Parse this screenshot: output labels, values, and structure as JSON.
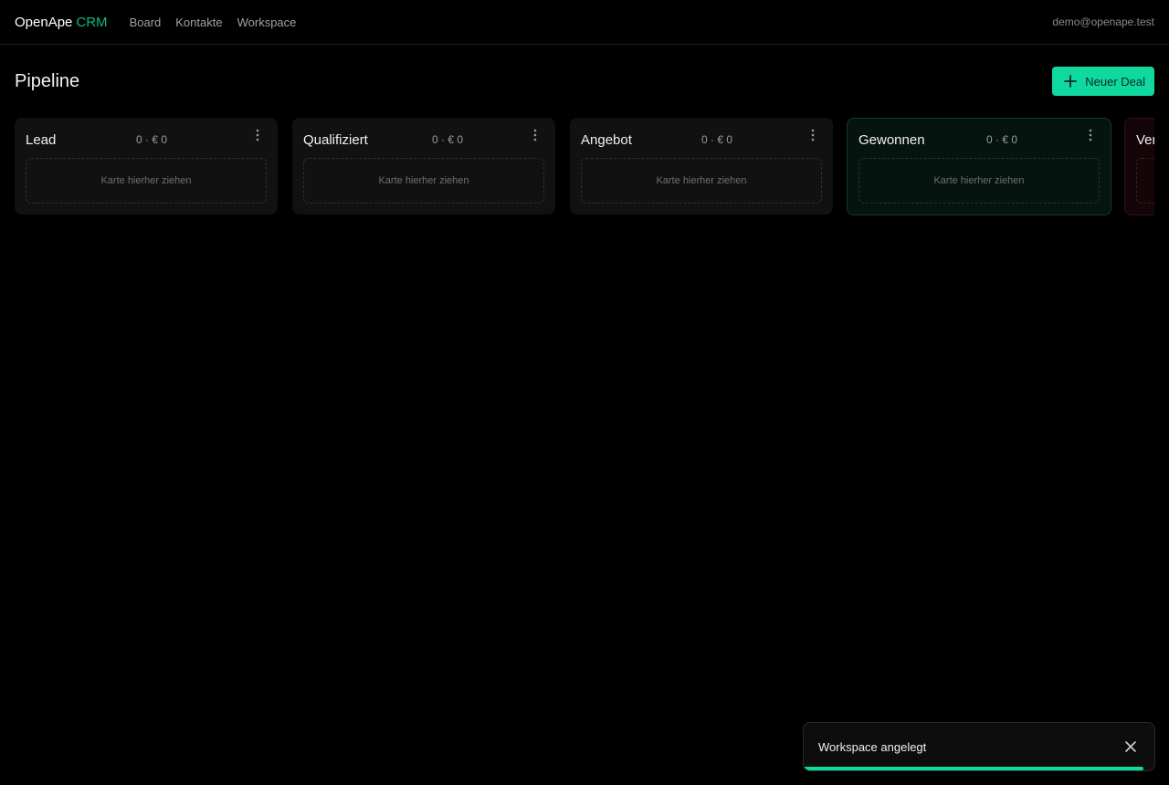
{
  "app": {
    "name": "OpenApe",
    "name_accent": "CRM"
  },
  "nav": {
    "items": [
      {
        "label": "Board"
      },
      {
        "label": "Kontakte"
      },
      {
        "label": "Workspace"
      }
    ]
  },
  "user": {
    "email": "demo@openape.test"
  },
  "page": {
    "title": "Pipeline",
    "new_deal_label": "Neuer Deal"
  },
  "columns": [
    {
      "title": "Lead",
      "meta": "0 · € 0",
      "dropzone": "Karte hierher ziehen"
    },
    {
      "title": "Qualifiziert",
      "meta": "0 · € 0",
      "dropzone": "Karte hierher ziehen"
    },
    {
      "title": "Angebot",
      "meta": "0 · € 0",
      "dropzone": "Karte hierher ziehen"
    },
    {
      "title": "Gewonnen",
      "meta": "0 · € 0",
      "dropzone": "Karte hierher ziehen"
    },
    {
      "title": "Ver",
      "meta": "",
      "dropzone": ""
    }
  ],
  "toast": {
    "message": "Workspace angelegt",
    "progress": 0.97
  },
  "colors": {
    "accent": "#10d9a0",
    "won": "#0c3f2d",
    "lost": "#3f0c18"
  },
  "icons": {
    "add": "plus-icon",
    "column_menu": "more-vertical-icon",
    "close": "close-icon"
  }
}
